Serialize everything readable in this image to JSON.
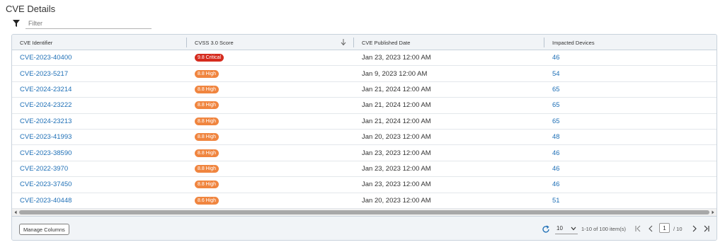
{
  "page": {
    "title": "CVE Details",
    "filter_placeholder": "Filter"
  },
  "table": {
    "columns": [
      "CVE Identifier",
      "CVSS 3.0 Score",
      "CVE Published Date",
      "Impacted Devices"
    ],
    "sort": {
      "column": "CVSS 3.0 Score",
      "direction": "descending"
    },
    "rows": [
      {
        "id": "CVE-2023-40400",
        "score": "9.8 Critical",
        "severity": "critical",
        "date": "Jan 23, 2023 12:00 AM",
        "devices": "46"
      },
      {
        "id": "CVE-2023-5217",
        "score": "8.8 High",
        "severity": "high",
        "date": "Jan 9, 2023 12:00 AM",
        "devices": "54"
      },
      {
        "id": "CVE-2024-23214",
        "score": "8.8 High",
        "severity": "high",
        "date": "Jan 21, 2024 12:00 AM",
        "devices": "65"
      },
      {
        "id": "CVE-2024-23222",
        "score": "8.8 High",
        "severity": "high",
        "date": "Jan 21, 2024 12:00 AM",
        "devices": "65"
      },
      {
        "id": "CVE-2024-23213",
        "score": "8.8 High",
        "severity": "high",
        "date": "Jan 21, 2024 12:00 AM",
        "devices": "65"
      },
      {
        "id": "CVE-2023-41993",
        "score": "8.8 High",
        "severity": "high",
        "date": "Jan 20, 2023 12:00 AM",
        "devices": "48"
      },
      {
        "id": "CVE-2023-38590",
        "score": "8.8 High",
        "severity": "high",
        "date": "Jan 23, 2023 12:00 AM",
        "devices": "46"
      },
      {
        "id": "CVE-2022-3970",
        "score": "8.8 High",
        "severity": "high",
        "date": "Jan 23, 2023 12:00 AM",
        "devices": "46"
      },
      {
        "id": "CVE-2023-37450",
        "score": "8.8 High",
        "severity": "high",
        "date": "Jan 23, 2023 12:00 AM",
        "devices": "46"
      },
      {
        "id": "CVE-2023-40448",
        "score": "8.6 High",
        "severity": "high",
        "date": "Jan 20, 2023 12:00 AM",
        "devices": "51"
      }
    ]
  },
  "footer": {
    "manage_columns": "Manage Columns",
    "page_size": "10",
    "range": "1-10 of 100 item(s)",
    "current_page": "1",
    "total_pages": "/ 10"
  },
  "colors": {
    "critical": "#d52b1e",
    "high": "#f0853f",
    "link": "#1e6fb6"
  },
  "icons": [
    "filter-icon",
    "sort-down-arrow-icon",
    "refresh-icon",
    "chevron-down-icon",
    "first-page-icon",
    "previous-page-icon",
    "next-page-icon",
    "last-page-icon"
  ]
}
